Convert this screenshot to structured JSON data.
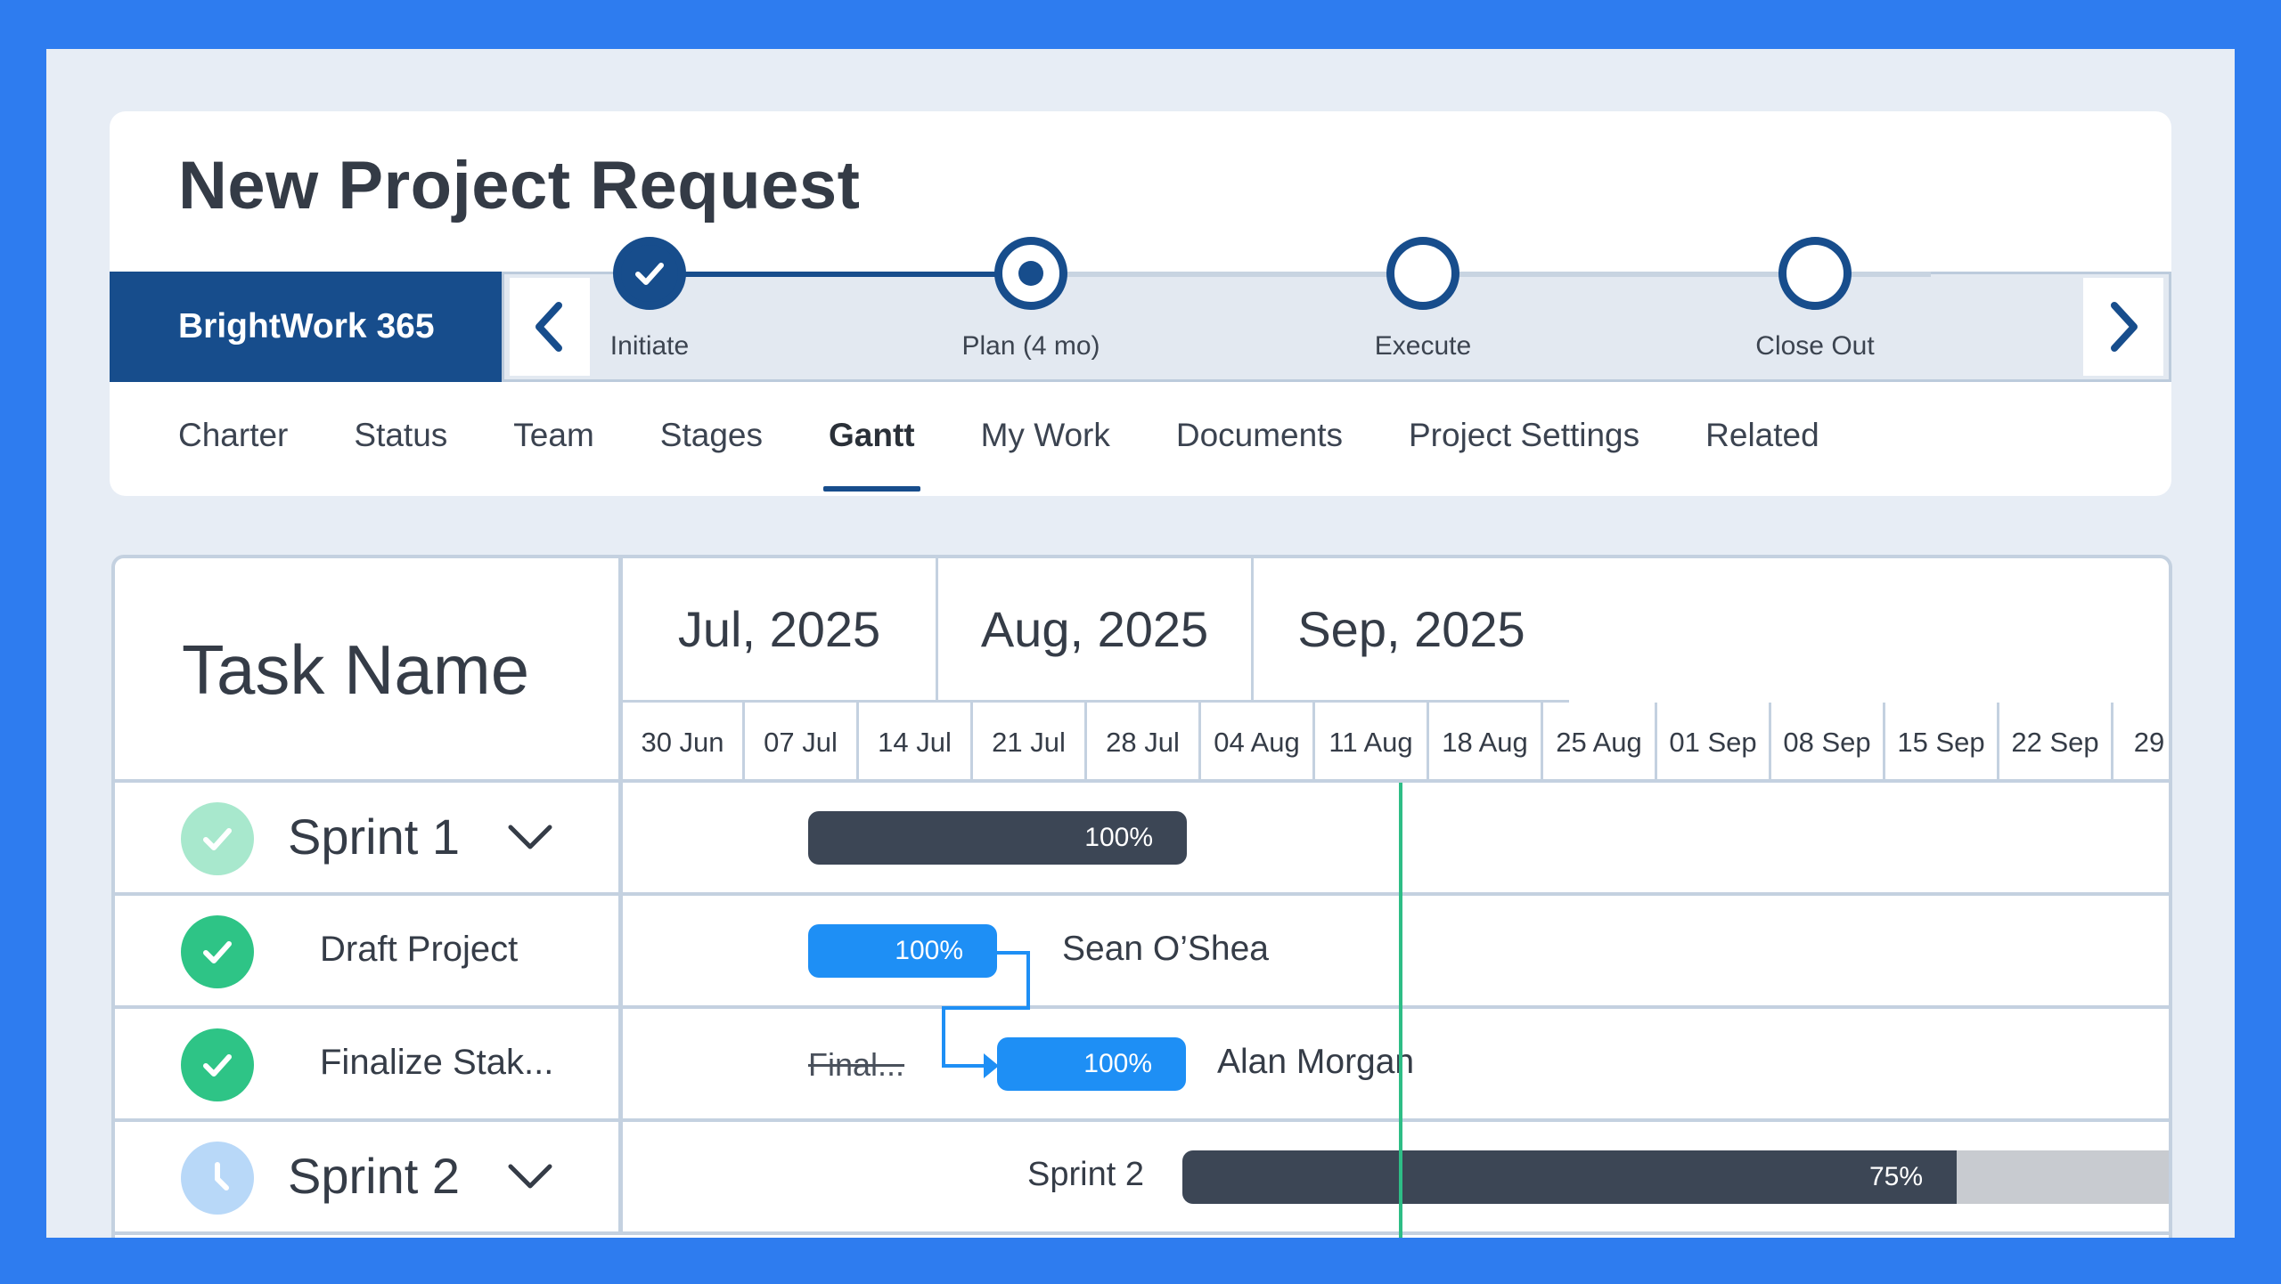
{
  "header": {
    "title": "New Project Request",
    "brand": "BrightWork 365"
  },
  "stages": [
    {
      "label": "Initiate",
      "state": "complete"
    },
    {
      "label": "Plan (4 mo)",
      "state": "current"
    },
    {
      "label": "Execute",
      "state": "upcoming"
    },
    {
      "label": "Close Out",
      "state": "upcoming"
    }
  ],
  "tabs": [
    "Charter",
    "Status",
    "Team",
    "Stages",
    "Gantt",
    "My Work",
    "Documents",
    "Project Settings",
    "Related"
  ],
  "active_tab": "Gantt",
  "gantt": {
    "task_header": "Task Name",
    "months": [
      "Jul, 2025",
      "Aug, 2025",
      "Sep, 2025"
    ],
    "weeks": [
      "30 Jun",
      "07 Jul",
      "14 Jul",
      "21 Jul",
      "28 Jul",
      "04 Aug",
      "11 Aug",
      "18 Aug",
      "25 Aug",
      "01 Sep",
      "08 Sep",
      "15 Sep",
      "22 Sep",
      "29"
    ],
    "rows": [
      {
        "name": "Sprint 1",
        "kind": "sprint",
        "status": "complete-light",
        "progress": "100%",
        "progress_value": 100
      },
      {
        "name": "Draft Project",
        "kind": "task",
        "status": "complete",
        "progress": "100%",
        "progress_value": 100,
        "assignee": "Sean O’Shea"
      },
      {
        "name": "Finalize Stak...",
        "kind": "task",
        "status": "complete",
        "progress": "100%",
        "progress_value": 100,
        "assignee": "Alan Morgan",
        "ghost_label": "Final..."
      },
      {
        "name": "Sprint 2",
        "kind": "sprint",
        "status": "in-progress",
        "progress": "75%",
        "progress_value": 75,
        "bar_label": "Sprint 2"
      }
    ]
  },
  "colors": {
    "page_border": "#2e7cef",
    "brand": "#174d8c",
    "bar_dark": "#3c4655",
    "bar_blue": "#1e8ff5",
    "complete_green": "#2ec486",
    "complete_light": "#a8e8cd",
    "in_progress": "#b8d8f8",
    "today_line": "#2ebd86"
  },
  "icons": {
    "prev": "chevron-left-icon",
    "next": "chevron-right-icon",
    "check": "check-icon",
    "clock": "clock-icon",
    "expand": "chevron-down-icon"
  }
}
